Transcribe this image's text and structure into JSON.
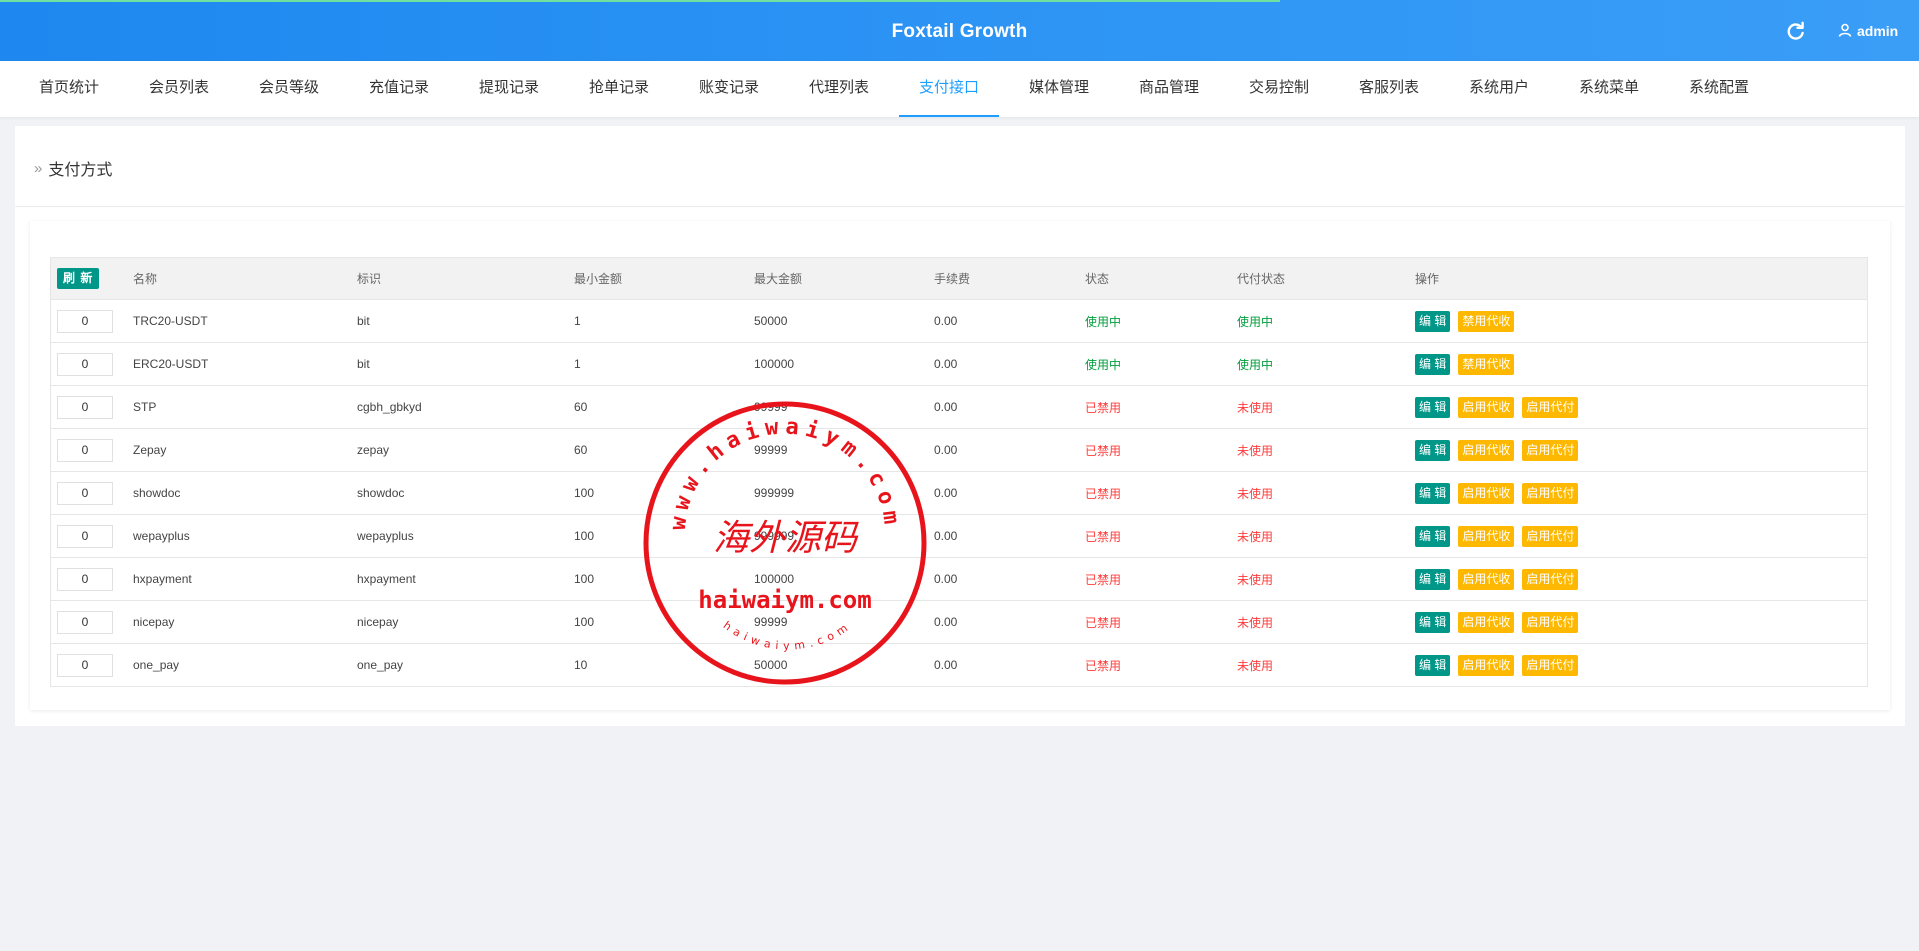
{
  "header": {
    "title": "Foxtail Growth",
    "refresh_icon": "refresh-icon",
    "user_icon": "user-icon",
    "user_name": "admin",
    "colors": {
      "bar": "#1e88f0",
      "accent_line": "#6fe0a0"
    }
  },
  "nav": {
    "active_index": 8,
    "active_color": "#1e9fff",
    "items": [
      {
        "label": "首页统计"
      },
      {
        "label": "会员列表"
      },
      {
        "label": "会员等级"
      },
      {
        "label": "充值记录"
      },
      {
        "label": "提现记录"
      },
      {
        "label": "抢单记录"
      },
      {
        "label": "账变记录"
      },
      {
        "label": "代理列表"
      },
      {
        "label": "支付接口"
      },
      {
        "label": "媒体管理"
      },
      {
        "label": "商品管理"
      },
      {
        "label": "交易控制"
      },
      {
        "label": "客服列表"
      },
      {
        "label": "系统用户"
      },
      {
        "label": "系统菜单"
      },
      {
        "label": "系统配置"
      }
    ]
  },
  "page": {
    "breadcrumb_icon": "double-chevron-right-icon",
    "title": "支付方式"
  },
  "table": {
    "refresh_label": "刷 新",
    "columns": {
      "name": "名称",
      "tag": "标识",
      "min": "最小金额",
      "max": "最大金额",
      "fee": "手续费",
      "status": "状态",
      "payout_status": "代付状态",
      "ops": "操作"
    },
    "rows": [
      {
        "sort": "0",
        "name": "TRC20-USDT",
        "tag": "bit",
        "min": "1",
        "max": "50000",
        "fee": "0.00",
        "status": "使用中",
        "payout_status": "使用中",
        "ops": [
          "编 辑",
          "禁用代收"
        ]
      },
      {
        "sort": "0",
        "name": "ERC20-USDT",
        "tag": "bit",
        "min": "1",
        "max": "100000",
        "fee": "0.00",
        "status": "使用中",
        "payout_status": "使用中",
        "ops": [
          "编 辑",
          "禁用代收"
        ]
      },
      {
        "sort": "0",
        "name": "STP",
        "tag": "cgbh_gbkyd",
        "min": "60",
        "max": "99999",
        "fee": "0.00",
        "status": "已禁用",
        "payout_status": "未使用",
        "ops": [
          "编 辑",
          "启用代收",
          "启用代付"
        ]
      },
      {
        "sort": "0",
        "name": "Zepay",
        "tag": "zepay",
        "min": "60",
        "max": "99999",
        "fee": "0.00",
        "status": "已禁用",
        "payout_status": "未使用",
        "ops": [
          "编 辑",
          "启用代收",
          "启用代付"
        ]
      },
      {
        "sort": "0",
        "name": "showdoc",
        "tag": "showdoc",
        "min": "100",
        "max": "999999",
        "fee": "0.00",
        "status": "已禁用",
        "payout_status": "未使用",
        "ops": [
          "编 辑",
          "启用代收",
          "启用代付"
        ]
      },
      {
        "sort": "0",
        "name": "wepayplus",
        "tag": "wepayplus",
        "min": "100",
        "max": "999999",
        "fee": "0.00",
        "status": "已禁用",
        "payout_status": "未使用",
        "ops": [
          "编 辑",
          "启用代收",
          "启用代付"
        ]
      },
      {
        "sort": "0",
        "name": "hxpayment",
        "tag": "hxpayment",
        "min": "100",
        "max": "100000",
        "fee": "0.00",
        "status": "已禁用",
        "payout_status": "未使用",
        "ops": [
          "编 辑",
          "启用代收",
          "启用代付"
        ]
      },
      {
        "sort": "0",
        "name": "nicepay",
        "tag": "nicepay",
        "min": "100",
        "max": "99999",
        "fee": "0.00",
        "status": "已禁用",
        "payout_status": "未使用",
        "ops": [
          "编 辑",
          "启用代收",
          "启用代付"
        ]
      },
      {
        "sort": "0",
        "name": "one_pay",
        "tag": "one_pay",
        "min": "10",
        "max": "50000",
        "fee": "0.00",
        "status": "已禁用",
        "payout_status": "未使用",
        "ops": [
          "编 辑",
          "启用代收",
          "启用代付"
        ]
      }
    ],
    "status_colors": {
      "active": "#009f3c",
      "disabled": "#ff3b3b"
    },
    "button_colors": {
      "edit": "#009688",
      "toggle": "#ffb800"
    }
  },
  "watermark": {
    "ring_text": "www.haiwaiym.com",
    "center_text": "海外源码",
    "main_text": "haiwaiym.com",
    "small_text": "haiwaiym.com",
    "color": "#e8141b"
  }
}
